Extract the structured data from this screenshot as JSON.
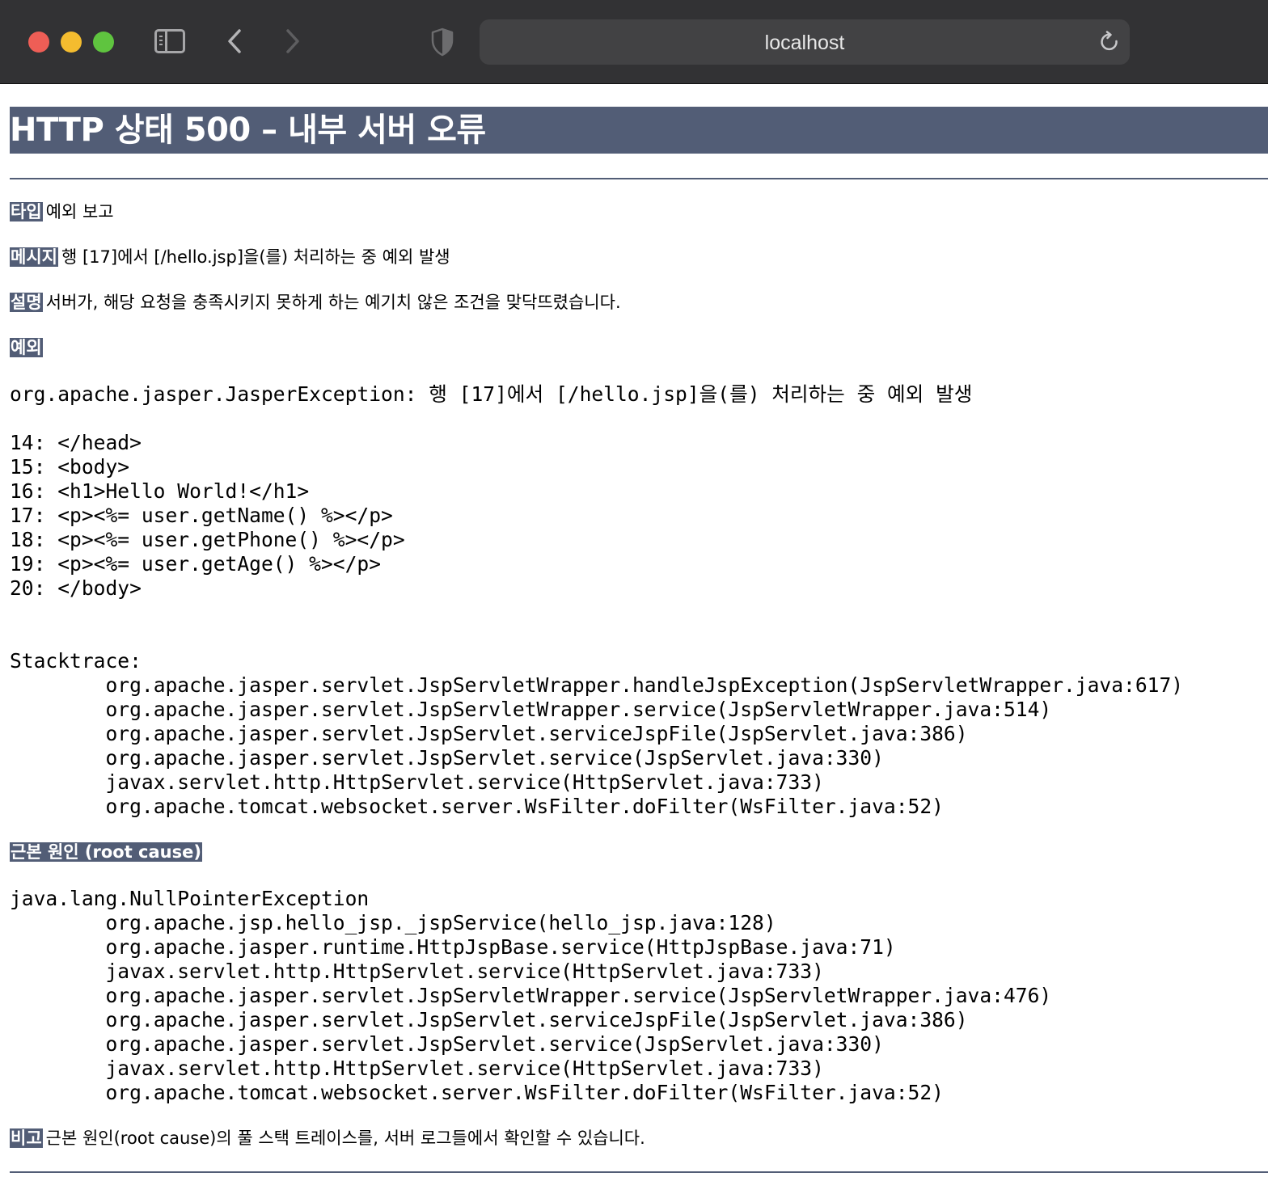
{
  "browser": {
    "url": "localhost"
  },
  "page": {
    "title": "HTTP 상태 500 – 내부 서버 오류",
    "type_label": "타입",
    "type_value": "예외 보고",
    "message_label": "메시지",
    "message_value": "행 [17]에서 [/hello.jsp]을(를) 처리하는 중 예외 발생",
    "description_label": "설명",
    "description_value": "서버가, 해당 요청을 충족시키지 못하게 하는 예기치 않은 조건을 맞닥뜨렸습니다.",
    "exception_label": "예외",
    "exception_text": "org.apache.jasper.JasperException: 행 [17]에서 [/hello.jsp]을(를) 처리하는 중 예외 발생\n\n14: </head>\n15: <body>\n16: <h1>Hello World!</h1>\n17: <p><%= user.getName() %></p>\n18: <p><%= user.getPhone() %></p>\n19: <p><%= user.getAge() %></p>\n20: </body>\n\n\nStacktrace:\n\torg.apache.jasper.servlet.JspServletWrapper.handleJspException(JspServletWrapper.java:617)\n\torg.apache.jasper.servlet.JspServletWrapper.service(JspServletWrapper.java:514)\n\torg.apache.jasper.servlet.JspServlet.serviceJspFile(JspServlet.java:386)\n\torg.apache.jasper.servlet.JspServlet.service(JspServlet.java:330)\n\tjavax.servlet.http.HttpServlet.service(HttpServlet.java:733)\n\torg.apache.tomcat.websocket.server.WsFilter.doFilter(WsFilter.java:52)",
    "root_cause_label": "근본 원인 (root cause)",
    "root_cause_text": "java.lang.NullPointerException\n\torg.apache.jsp.hello_jsp._jspService(hello_jsp.java:128)\n\torg.apache.jasper.runtime.HttpJspBase.service(HttpJspBase.java:71)\n\tjavax.servlet.http.HttpServlet.service(HttpServlet.java:733)\n\torg.apache.jasper.servlet.JspServletWrapper.service(JspServletWrapper.java:476)\n\torg.apache.jasper.servlet.JspServlet.serviceJspFile(JspServlet.java:386)\n\torg.apache.jasper.servlet.JspServlet.service(JspServlet.java:330)\n\tjavax.servlet.http.HttpServlet.service(HttpServlet.java:733)\n\torg.apache.tomcat.websocket.server.WsFilter.doFilter(WsFilter.java:52)",
    "note_label": "비고",
    "note_value": "근본 원인(root cause)의 풀 스택 트레이스를, 서버 로그들에서 확인할 수 있습니다."
  },
  "colors": {
    "chrome_bg": "#323234",
    "urlbar_bg": "#424244",
    "tomcat_header": "#525d76",
    "close": "#ee5e56",
    "minimize": "#f4bc2f",
    "zoom": "#5fc43f"
  },
  "icons": {
    "sidebar": "sidebar-icon",
    "back": "chevron-left-icon",
    "forward": "chevron-right-icon",
    "privacy": "shield-icon",
    "reload": "reload-icon"
  }
}
